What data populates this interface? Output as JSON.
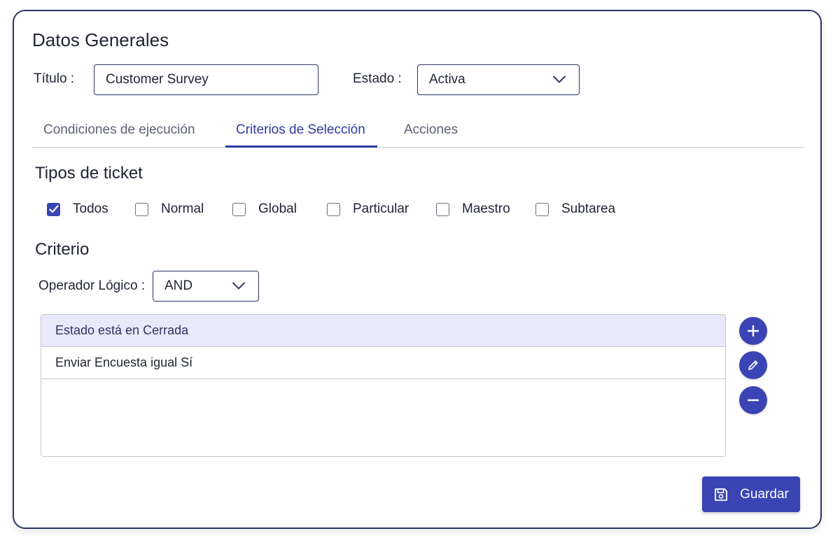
{
  "general": {
    "title": "Datos Generales",
    "titulo_label": "Título :",
    "titulo_value": "Customer Survey",
    "estado_label": "Estado :",
    "estado_value": "Activa"
  },
  "tabs": [
    {
      "label": "Condiciones de ejecución",
      "active": false
    },
    {
      "label": "Criterios de Selección",
      "active": true
    },
    {
      "label": "Acciones",
      "active": false
    }
  ],
  "ticket_types": {
    "heading": "Tipos de ticket",
    "options": [
      {
        "label": "Todos",
        "checked": true
      },
      {
        "label": "Normal",
        "checked": false
      },
      {
        "label": "Global",
        "checked": false
      },
      {
        "label": "Particular",
        "checked": false
      },
      {
        "label": "Maestro",
        "checked": false
      },
      {
        "label": "Subtarea",
        "checked": false
      }
    ]
  },
  "criteria": {
    "heading": "Criterio",
    "operator_label": "Operador Lógico :",
    "operator_value": "AND",
    "rows": [
      {
        "text": "Estado está en Cerrada",
        "selected": true
      },
      {
        "text": "Enviar Encuesta igual Sí",
        "selected": false
      }
    ]
  },
  "actions": {
    "add_icon": "plus-icon",
    "edit_icon": "pencil-icon",
    "remove_icon": "minus-icon"
  },
  "save": {
    "label": "Guardar",
    "icon": "floppy-disk-icon"
  },
  "colors": {
    "accent": "#3b44b5",
    "border": "#2c3563",
    "selected_row": "#e9e9f9"
  }
}
